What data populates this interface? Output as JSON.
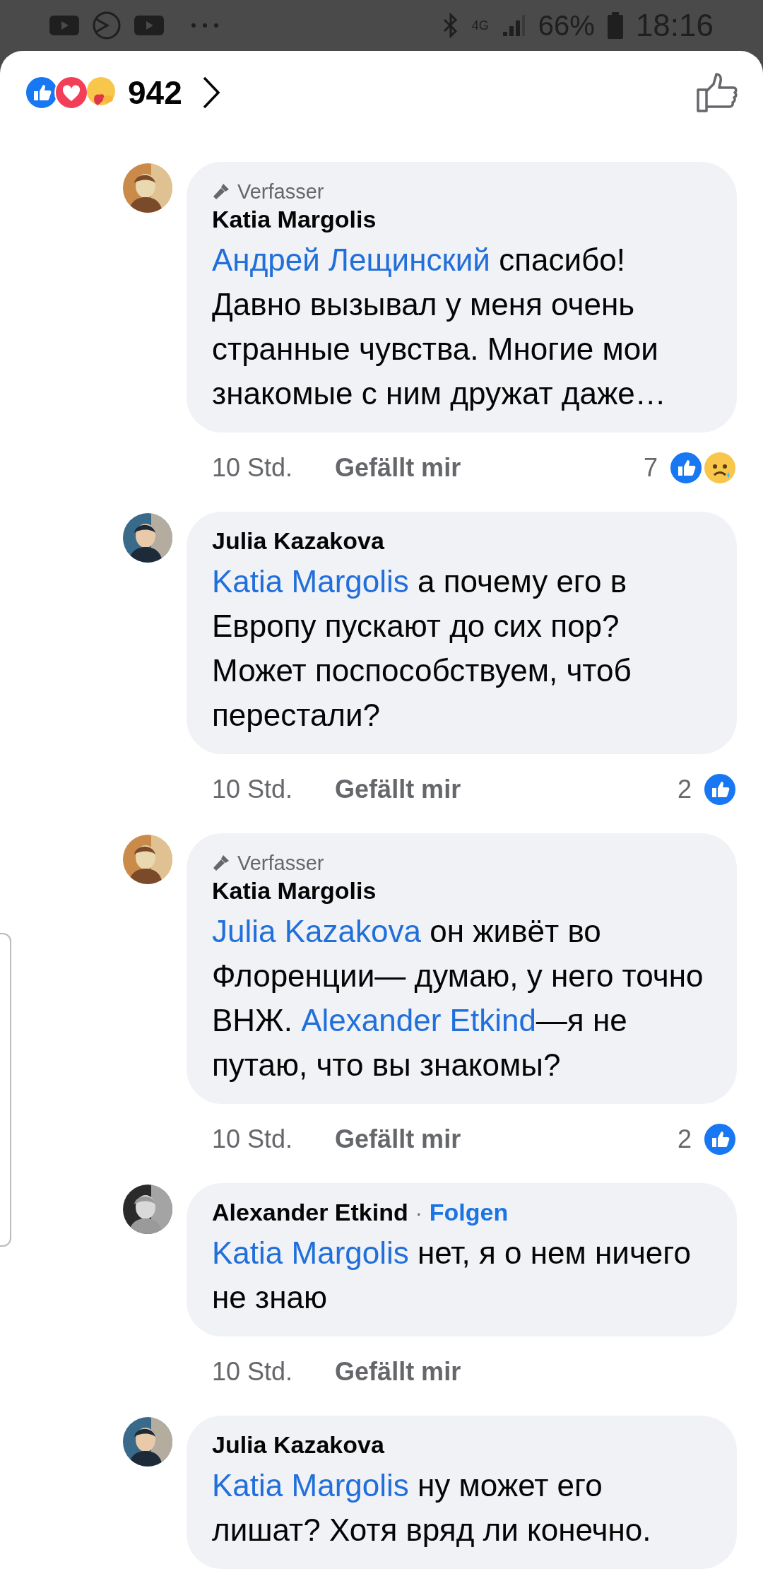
{
  "status_bar": {
    "network": "4G",
    "battery": "66%",
    "time": "18:16"
  },
  "reactions_header": {
    "reactions": [
      {
        "kind": "like"
      },
      {
        "kind": "love"
      },
      {
        "kind": "care"
      }
    ],
    "count": "942"
  },
  "comments": [
    {
      "author_badge": "Verfasser",
      "author": "Katia Margolis",
      "parts": [
        {
          "kind": "mention",
          "text": "Андрей Лещинский"
        },
        {
          "kind": "text",
          "text": " спасибо! Давно вызывал у меня очень странные чувства. Многие мои знакомые с ним дружат даже…"
        }
      ],
      "time": "10 Std.",
      "like_label": "Gefällt mir",
      "reaction_count": "7",
      "reactions": [
        {
          "kind": "like"
        },
        {
          "kind": "sad"
        }
      ]
    },
    {
      "author": "Julia Kazakova",
      "parts": [
        {
          "kind": "mention",
          "text": "Katia Margolis"
        },
        {
          "kind": "text",
          "text": " а почему его в Европу пускают до сих пор? Может поспособствуем, чтоб перестали?"
        }
      ],
      "time": "10 Std.",
      "like_label": "Gefällt mir",
      "reaction_count": "2",
      "reactions": [
        {
          "kind": "like"
        }
      ]
    },
    {
      "author_badge": "Verfasser",
      "author": "Katia Margolis",
      "parts": [
        {
          "kind": "mention",
          "text": "Julia Kazakova"
        },
        {
          "kind": "text",
          "text": " он живёт во Флоренции— думаю, у него точно ВНЖ. "
        },
        {
          "kind": "mention",
          "text": "Alexander Etkind"
        },
        {
          "kind": "text",
          "text": "—я не путаю, что вы знакомы?"
        }
      ],
      "time": "10 Std.",
      "like_label": "Gefällt mir",
      "reaction_count": "2",
      "reactions": [
        {
          "kind": "like"
        }
      ]
    },
    {
      "author": "Alexander Etkind",
      "separator": "·",
      "follow": "Folgen",
      "parts": [
        {
          "kind": "mention",
          "text": "Katia Margolis"
        },
        {
          "kind": "text",
          "text": " нет, я о нем ничего не знаю"
        }
      ],
      "time": "10 Std.",
      "like_label": "Gefällt mir"
    },
    {
      "author": "Julia Kazakova",
      "parts": [
        {
          "kind": "mention",
          "text": "Katia Margolis"
        },
        {
          "kind": "text",
          "text": " ну может его лишат? Хотя вряд ли конечно."
        }
      ]
    }
  ]
}
